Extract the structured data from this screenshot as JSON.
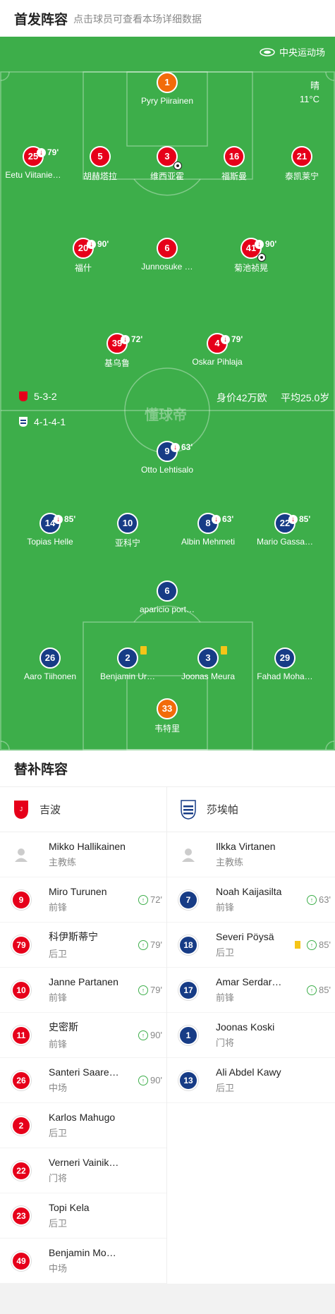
{
  "header": {
    "title": "首发阵容",
    "subtitle": "点击球员可查看本场详细数据"
  },
  "venue": "中央运动场",
  "weather": {
    "cond": "晴",
    "temp": "11°C"
  },
  "home": {
    "name": "吉波",
    "formation": "5-3-2",
    "value": "身价42万欧",
    "avg_age": "平均25.0岁",
    "color": "#e6001a"
  },
  "away": {
    "name": "莎埃帕",
    "formation": "4-1-4-1",
    "color": "#173c86"
  },
  "watermark": "懂球帝",
  "pitch_players": [
    {
      "num": "1",
      "name": "Pyry Piirainen",
      "team": "gk"
    },
    {
      "num": "25",
      "name": "Eetu Viitanie…",
      "team": "home",
      "sub": "79'"
    },
    {
      "num": "5",
      "name": "胡赫塔拉",
      "team": "home"
    },
    {
      "num": "3",
      "name": "维西亚霍",
      "team": "home",
      "goal": true
    },
    {
      "num": "16",
      "name": "福斯曼",
      "team": "home"
    },
    {
      "num": "21",
      "name": "泰凯莱宁",
      "team": "home"
    },
    {
      "num": "20",
      "name": "福什",
      "team": "home",
      "sub": "90'"
    },
    {
      "num": "6",
      "name": "Junnosuke …",
      "team": "home"
    },
    {
      "num": "41",
      "name": "菊池祯晃",
      "team": "home",
      "sub": "90'",
      "goal": true
    },
    {
      "num": "39",
      "name": "基乌鲁",
      "team": "home",
      "sub": "72'"
    },
    {
      "num": "4",
      "name": "Oskar Pihlaja",
      "team": "home",
      "sub": "79'"
    },
    {
      "num": "9",
      "name": "Otto Lehtisalo",
      "team": "away",
      "sub": "63'"
    },
    {
      "num": "14",
      "name": "Topias Helle",
      "team": "away",
      "sub": "85'"
    },
    {
      "num": "10",
      "name": "亚科宁",
      "team": "away"
    },
    {
      "num": "8",
      "name": "Albin Mehmeti",
      "team": "away",
      "sub": "63'"
    },
    {
      "num": "22",
      "name": "Mario Gassa…",
      "team": "away",
      "sub": "85'"
    },
    {
      "num": "6",
      "name": "aparicio port…",
      "team": "away"
    },
    {
      "num": "26",
      "name": "Aaro Tiihonen",
      "team": "away"
    },
    {
      "num": "2",
      "name": "Benjamin Ur…",
      "team": "away",
      "yellow": true
    },
    {
      "num": "3",
      "name": "Joonas Meura",
      "team": "away",
      "yellow": true
    },
    {
      "num": "29",
      "name": "Fahad Moha…",
      "team": "away"
    },
    {
      "num": "33",
      "name": "韦特里",
      "team": "gk"
    }
  ],
  "bench": {
    "title": "替补阵容",
    "home_coach": {
      "name": "Mikko Hallikainen",
      "role": "主教练"
    },
    "away_coach": {
      "name": "Ilkka Virtanen",
      "role": "主教练"
    },
    "home": [
      {
        "num": "9",
        "name": "Miro Turunen",
        "pos": "前锋",
        "time": "72'"
      },
      {
        "num": "79",
        "name": "科伊斯蒂宁",
        "pos": "后卫",
        "time": "79'"
      },
      {
        "num": "10",
        "name": "Janne Partanen",
        "pos": "前锋",
        "time": "79'"
      },
      {
        "num": "11",
        "name": "史密斯",
        "pos": "前锋",
        "time": "90'"
      },
      {
        "num": "26",
        "name": "Santeri Saare…",
        "pos": "中场",
        "time": "90'"
      },
      {
        "num": "2",
        "name": "Karlos Mahugo",
        "pos": "后卫"
      },
      {
        "num": "22",
        "name": "Verneri Vainik…",
        "pos": "门将"
      },
      {
        "num": "23",
        "name": "Topi Kela",
        "pos": "后卫"
      },
      {
        "num": "49",
        "name": "Benjamin Mo…",
        "pos": "中场"
      }
    ],
    "away": [
      {
        "num": "7",
        "name": "Noah Kaijasilta",
        "pos": "前锋",
        "time": "63'"
      },
      {
        "num": "18",
        "name": "Severi Pöysä",
        "pos": "后卫",
        "time": "85'",
        "yellow": true
      },
      {
        "num": "17",
        "name": "Amar Serdar…",
        "pos": "前锋",
        "time": "85'"
      },
      {
        "num": "1",
        "name": "Joonas Koski",
        "pos": "门将"
      },
      {
        "num": "13",
        "name": "Ali Abdel Kawy",
        "pos": "后卫"
      }
    ]
  }
}
